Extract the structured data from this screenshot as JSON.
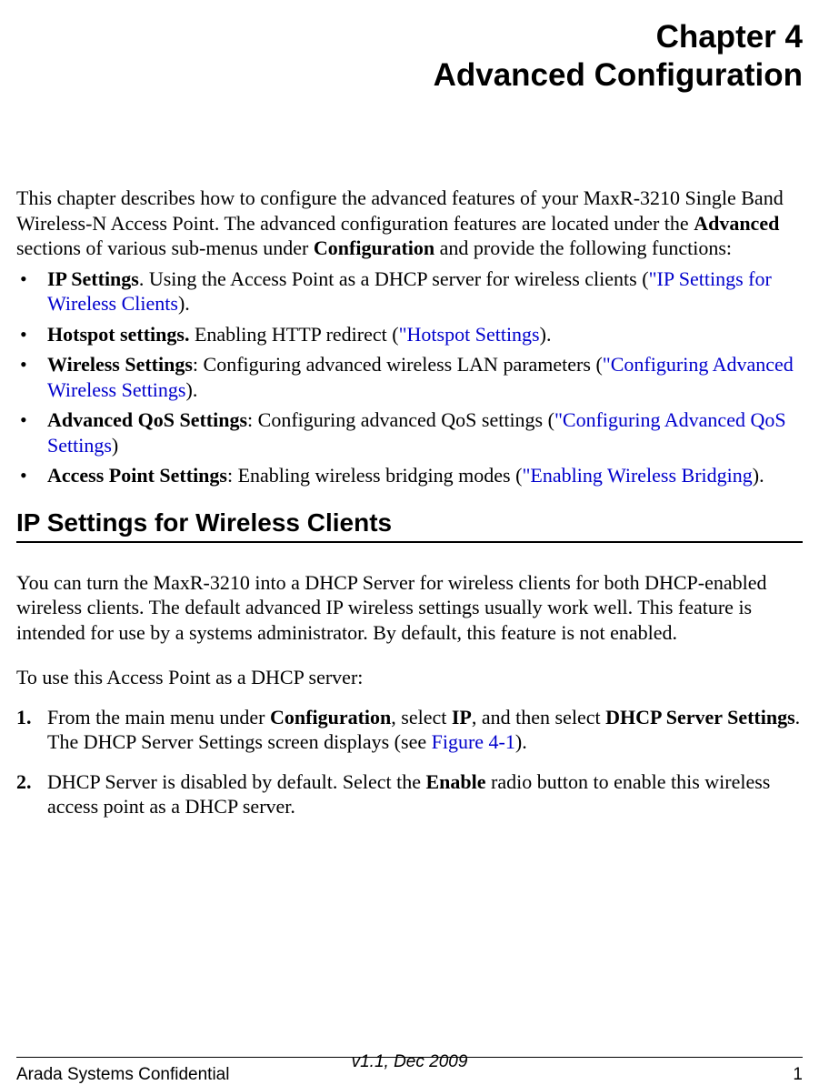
{
  "chapter": {
    "number": "Chapter 4",
    "title": "Advanced Configuration"
  },
  "intro_before_bold1": "This chapter describes how to configure the advanced features of your MaxR-3210 Single Band Wireless-N Access Point. The advanced configuration features are located under the ",
  "intro_bold1": "Advanced",
  "intro_mid": " sections of various sub-menus under ",
  "intro_bold2": "Configuration",
  "intro_after_bold2": " and provide the following functions:",
  "bullets": {
    "b1_bold": "IP Settings",
    "b1_text": ". Using the Access Point as a DHCP server for wireless clients (",
    "b1_link": "\"IP Settings for Wireless Clients",
    "b1_after": ").",
    "b2_bold": "Hotspot settings.",
    "b2_text": " Enabling HTTP redirect (",
    "b2_link": "\"Hotspot Settings",
    "b2_after": ").",
    "b3_bold": "Wireless Settings",
    "b3_text": ": Configuring advanced wireless LAN parameters (",
    "b3_link": "\"Configuring Advanced Wireless Settings",
    "b3_after": ").",
    "b4_bold": "Advanced QoS Settings",
    "b4_text": ": Configuring advanced QoS settings (",
    "b4_link": "\"Configuring Advanced QoS Settings",
    "b4_after": ")",
    "b5_bold": "Access Point Settings",
    "b5_text": ": Enabling wireless bridging modes (",
    "b5_link": "\"Enabling Wireless Bridging",
    "b5_after": ")."
  },
  "section_heading": "IP Settings for Wireless Clients",
  "section_para1": "You can turn the MaxR-3210 into a DHCP Server for wireless clients for both DHCP-enabled wireless clients. The default advanced IP wireless settings usually work well. This feature is intended for use by a systems administrator. By default, this feature is not enabled.",
  "section_para2": "To use this Access Point as a DHCP server:",
  "steps": {
    "s1_num": "1.",
    "s1_a": "From the main menu under ",
    "s1_b1": "Configuration",
    "s1_b": ", select ",
    "s1_b2": "IP",
    "s1_c": ", and then select ",
    "s1_b3": "DHCP Server Settings",
    "s1_d": ". The DHCP Server Settings screen displays (see ",
    "s1_link": "Figure 4-1",
    "s1_e": ").",
    "s2_num": "2.",
    "s2_a": "DHCP Server is disabled by default. Select the ",
    "s2_b1": "Enable",
    "s2_b": " radio button to enable this wireless access point as a DHCP server."
  },
  "footer": {
    "left": "Arada Systems Confidential",
    "right": "1",
    "version": "v1.1, Dec 2009"
  }
}
